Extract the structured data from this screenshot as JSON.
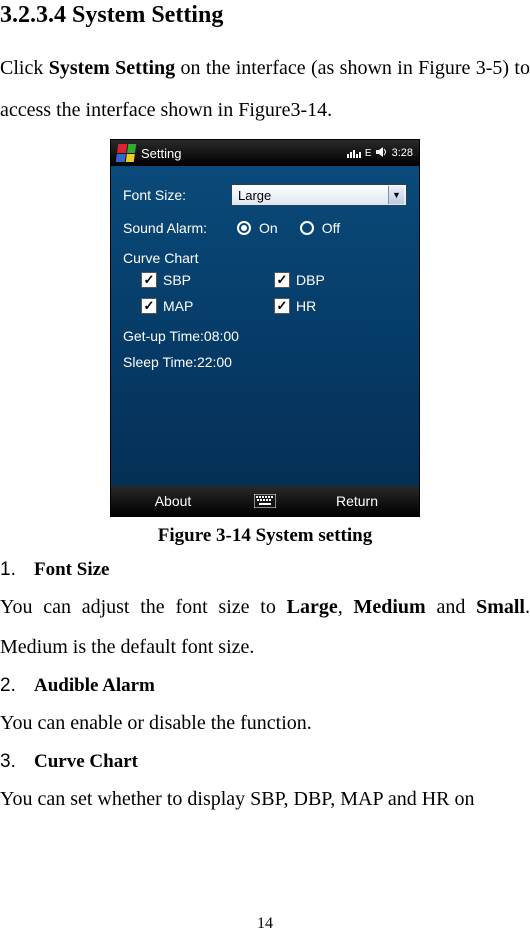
{
  "heading": "3.2.3.4 System Setting",
  "intro_parts": {
    "pre": "Click ",
    "bold": "System Setting",
    "post": " on the interface (as shown in Figure 3-5) to access the interface shown in Figure3-14."
  },
  "device": {
    "titlebar": {
      "app_name": "Setting",
      "signal_icon": "signal-icon",
      "e_icon": "E",
      "volume_icon": "volume-icon",
      "time": "3:28"
    },
    "screen": {
      "font_size_label": "Font Size:",
      "font_size_value": "Large",
      "sound_alarm_label": "Sound Alarm:",
      "sound_on": "On",
      "sound_off": "Off",
      "sound_selected": "on",
      "curve_chart_label": "Curve Chart",
      "checks": [
        {
          "label": "SBP",
          "checked": true
        },
        {
          "label": "DBP",
          "checked": true
        },
        {
          "label": "MAP",
          "checked": true
        },
        {
          "label": "HR",
          "checked": true
        }
      ],
      "getup_label": "Get-up Time:",
      "getup_value": "08:00",
      "sleep_label": "Sleep Time:",
      "sleep_value": "22:00"
    },
    "menubar": {
      "left": "About",
      "right": "Return"
    }
  },
  "caption": "Figure 3-14 System setting",
  "items": [
    {
      "num": "1.",
      "title": "Font Size"
    },
    {
      "num": "2.",
      "title": "Audible Alarm"
    },
    {
      "num": "3.",
      "title": "Curve Chart"
    }
  ],
  "p1_parts": {
    "a": "You can adjust the font size to ",
    "b1": "Large",
    "c": ", ",
    "b2": "Medium",
    "d": " and ",
    "b3": "Small",
    "e": ". Medium is the default font size."
  },
  "p2": "You can enable or disable the function.",
  "p3": "You can set whether to display SBP, DBP, MAP and HR on",
  "page_num": "14"
}
